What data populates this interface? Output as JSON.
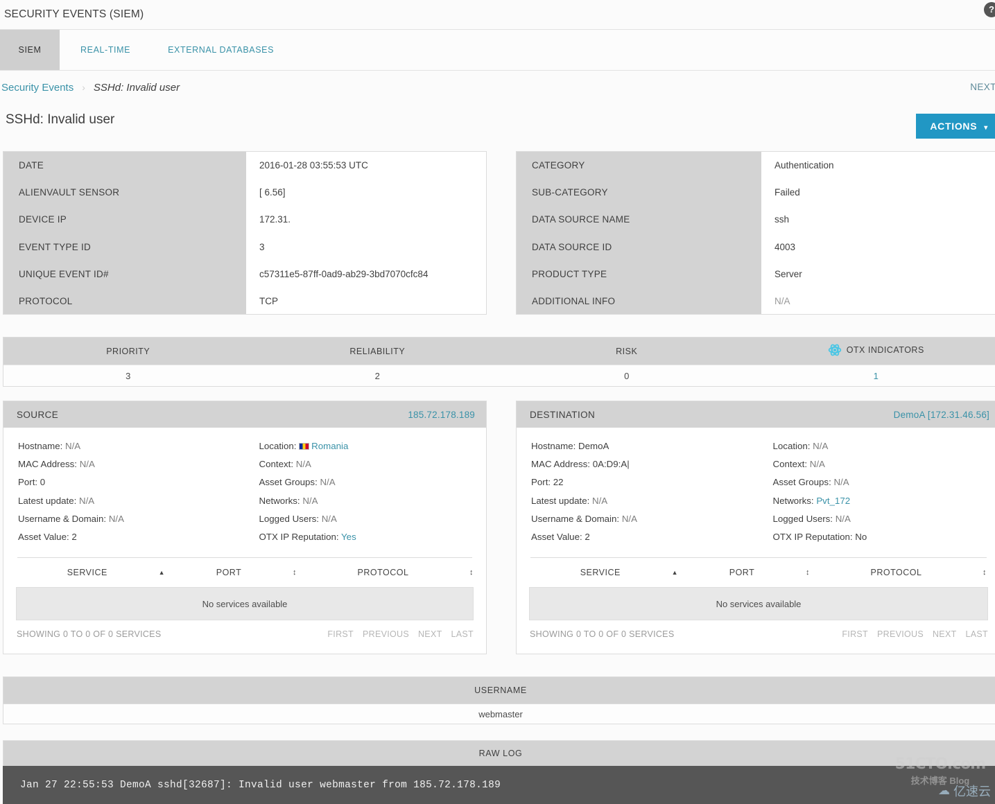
{
  "header": {
    "title": "SECURITY EVENTS (SIEM)",
    "help_icon": "help-circle-icon"
  },
  "tabs": [
    {
      "label": "SIEM",
      "active": true
    },
    {
      "label": "REAL-TIME",
      "active": false
    },
    {
      "label": "EXTERNAL DATABASES",
      "active": false
    }
  ],
  "breadcrumb": {
    "root": "Security Events",
    "separator": "›",
    "current": "SSHd: Invalid user"
  },
  "next_link": "NEXT >",
  "page_title": "SSHd: Invalid user",
  "actions_button": {
    "label": "ACTIONS",
    "caret": "▾",
    "color": "#2197c4"
  },
  "detail_left": {
    "rows": [
      {
        "label": "DATE",
        "value": "2016-01-28 03:55:53 UTC",
        "muted": false
      },
      {
        "label": "ALIENVAULT SENSOR",
        "value": "[                 6.56]",
        "muted": false,
        "redacted": true
      },
      {
        "label": "DEVICE IP",
        "value": "172.31.",
        "muted": false,
        "redacted": true
      },
      {
        "label": "EVENT TYPE ID",
        "value": "3",
        "muted": false
      },
      {
        "label": "UNIQUE EVENT ID#",
        "value": "c57311e5-87ff-0ad9-ab29-3bd7070cfc84",
        "muted": false
      },
      {
        "label": "PROTOCOL",
        "value": "TCP",
        "muted": false
      }
    ]
  },
  "detail_right": {
    "rows": [
      {
        "label": "CATEGORY",
        "value": "Authentication",
        "muted": false
      },
      {
        "label": "SUB-CATEGORY",
        "value": "Failed",
        "muted": false
      },
      {
        "label": "DATA SOURCE NAME",
        "value": "ssh",
        "muted": false
      },
      {
        "label": "DATA SOURCE ID",
        "value": "4003",
        "muted": false
      },
      {
        "label": "PRODUCT TYPE",
        "value": "Server",
        "muted": false
      },
      {
        "label": "ADDITIONAL INFO",
        "value": "N/A",
        "muted": true
      }
    ]
  },
  "metrics": {
    "headers": [
      "PRIORITY",
      "RELIABILITY",
      "RISK",
      "OTX INDICATORS"
    ],
    "otx_icon": "otx-atom-icon",
    "values": [
      "3",
      "2",
      "0",
      "1"
    ],
    "otx_value_is_link": true,
    "link_color": "#3a92a8"
  },
  "source": {
    "title": "SOURCE",
    "ip": "185.72.178.189",
    "left_fields": [
      {
        "key": "Hostname",
        "value": "N/A",
        "style": "muted"
      },
      {
        "key": "MAC Address",
        "value": "N/A",
        "style": "muted"
      },
      {
        "key": "Port",
        "value": "0",
        "style": "dark"
      },
      {
        "key": "Latest update",
        "value": "N/A",
        "style": "muted"
      },
      {
        "key": "Username & Domain",
        "value": "N/A",
        "style": "muted"
      },
      {
        "key": "Asset Value",
        "value": "2",
        "style": "dark"
      }
    ],
    "right_fields": [
      {
        "key": "Location",
        "value": "Romania",
        "style": "link",
        "flag": "ro-flag-icon"
      },
      {
        "key": "Context",
        "value": "N/A",
        "style": "muted"
      },
      {
        "key": "Asset Groups",
        "value": "N/A",
        "style": "muted"
      },
      {
        "key": "Networks",
        "value": "N/A",
        "style": "muted"
      },
      {
        "key": "Logged Users",
        "value": "N/A",
        "style": "muted"
      },
      {
        "key": "OTX IP Reputation",
        "value": "Yes",
        "style": "link"
      }
    ],
    "services": {
      "columns": [
        "SERVICE",
        "PORT",
        "PROTOCOL"
      ],
      "sort_states": [
        "asc",
        "both",
        "both"
      ],
      "empty_message": "No services available",
      "showing": "SHOWING 0 TO 0 OF 0 SERVICES",
      "pager": [
        "FIRST",
        "PREVIOUS",
        "NEXT",
        "LAST"
      ]
    }
  },
  "destination": {
    "title": "DESTINATION",
    "ip": "DemoA [172.31.46.56]",
    "left_fields": [
      {
        "key": "Hostname",
        "value": "DemoA",
        "style": "dark"
      },
      {
        "key": "MAC Address",
        "value": "0A:D9:A|",
        "style": "dark"
      },
      {
        "key": "Port",
        "value": "22",
        "style": "dark"
      },
      {
        "key": "Latest update",
        "value": "N/A",
        "style": "muted"
      },
      {
        "key": "Username & Domain",
        "value": "N/A",
        "style": "muted"
      },
      {
        "key": "Asset Value",
        "value": "2",
        "style": "dark"
      }
    ],
    "right_fields": [
      {
        "key": "Location",
        "value": "N/A",
        "style": "muted"
      },
      {
        "key": "Context",
        "value": "N/A",
        "style": "muted"
      },
      {
        "key": "Asset Groups",
        "value": "N/A",
        "style": "muted"
      },
      {
        "key": "Networks",
        "value": "Pvt_172",
        "style": "link"
      },
      {
        "key": "Logged Users",
        "value": "N/A",
        "style": "muted"
      },
      {
        "key": "OTX IP Reputation",
        "value": "No",
        "style": "dark"
      }
    ],
    "services": {
      "columns": [
        "SERVICE",
        "PORT",
        "PROTOCOL"
      ],
      "sort_states": [
        "asc",
        "both",
        "both"
      ],
      "empty_message": "No services available",
      "showing": "SHOWING 0 TO 0 OF 0 SERVICES",
      "pager": [
        "FIRST",
        "PREVIOUS",
        "NEXT",
        "LAST"
      ]
    }
  },
  "username_table": {
    "header": "USERNAME",
    "value": "webmaster"
  },
  "raw_log": {
    "header": "RAW LOG",
    "text": "Jan 27 22:55:53 DemoA sshd[32687]: Invalid user webmaster from 185.72.178.189"
  },
  "watermarks": {
    "primary": "51CTO.com",
    "primary_sub": "技术博客  Blog",
    "secondary": "亿速云"
  }
}
